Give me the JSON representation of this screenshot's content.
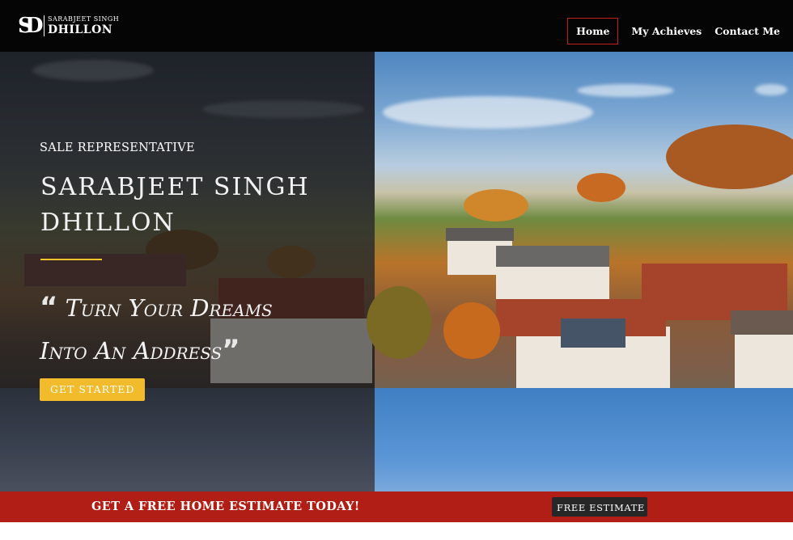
{
  "header": {
    "logo": {
      "monogram": "SD",
      "line1": "SARABJEET SINGH",
      "line2": "DHILLON"
    },
    "nav": [
      {
        "label": "Home",
        "active": true
      },
      {
        "label": "My Achieves",
        "active": false
      },
      {
        "label": "Contact Me",
        "active": false
      }
    ]
  },
  "hero": {
    "role": "SALE REPRESENTATIVE",
    "name_line1": "SARABJEET SINGH",
    "name_line2": "DHILLON",
    "tagline_line1": "Turn Your Dreams",
    "tagline_line2": "Into An Address",
    "open_quote": "“",
    "close_quote": "”",
    "cta_label": "GET STARTED"
  },
  "banner": {
    "text": "GET A FREE HOME ESTIMATE TODAY!",
    "button_label": "FREE ESTIMATE"
  },
  "colors": {
    "header_bg": "#050505",
    "accent_gold": "#f2bb2b",
    "banner_red": "#b01e15",
    "nav_active_border": "#c41e1e"
  }
}
